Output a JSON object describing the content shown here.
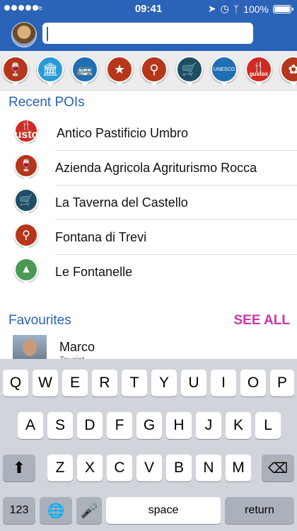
{
  "status_bar": {
    "time": "09:41",
    "battery": "100%",
    "icons": [
      "signal-dots-icon",
      "wifi-icon",
      "location-arrow-icon",
      "alarm-icon",
      "bluetooth-icon",
      "battery-icon"
    ]
  },
  "header": {
    "search_value": "",
    "search_placeholder": ""
  },
  "categories": [
    {
      "icon": "wine-glass-icon",
      "color": "#b5361b"
    },
    {
      "icon": "column-icon",
      "color": "#2b9bd6"
    },
    {
      "icon": "bus-icon",
      "color": "#1f6fb5"
    },
    {
      "icon": "festival-icon",
      "color": "#d12a22"
    },
    {
      "icon": "map-pin-icon",
      "color": "#b5361b"
    },
    {
      "icon": "shopping-cart-icon",
      "color": "#1d4e63"
    },
    {
      "icon": "unesco-icon",
      "color": "#1f6fb5",
      "text": "UNESCO"
    },
    {
      "icon": "gustox-icon",
      "color": "#d12a22",
      "text": "gustox"
    },
    {
      "icon": "leaf-icon",
      "color": "#b5361b"
    }
  ],
  "recent": {
    "title": "Recent POIs",
    "items": [
      {
        "label": "Antico Pastificio Umbro",
        "icon": "gustox-icon",
        "icon_text": "gustox"
      },
      {
        "label": "Azienda Agricola Agriturismo Rocca",
        "icon": "wine-glass-icon"
      },
      {
        "label": "La Taverna del Castello",
        "icon": "shopping-cart-icon"
      },
      {
        "label": "Fontana di Trevi",
        "icon": "map-pin-icon"
      },
      {
        "label": "Le Fontanelle",
        "icon": "water-park-icon"
      }
    ]
  },
  "favourites": {
    "title": "Favourites",
    "see_all": "SEE ALL",
    "items": [
      {
        "name": "Marco",
        "subtitle": "Tourist"
      }
    ]
  },
  "keyboard": {
    "row1": [
      "Q",
      "W",
      "E",
      "R",
      "T",
      "Y",
      "U",
      "I",
      "O",
      "P"
    ],
    "row2": [
      "A",
      "S",
      "D",
      "F",
      "G",
      "H",
      "J",
      "K",
      "L"
    ],
    "row3": [
      "Z",
      "X",
      "C",
      "V",
      "B",
      "N",
      "M"
    ],
    "numbers": "123",
    "space": "space",
    "return": "return"
  }
}
